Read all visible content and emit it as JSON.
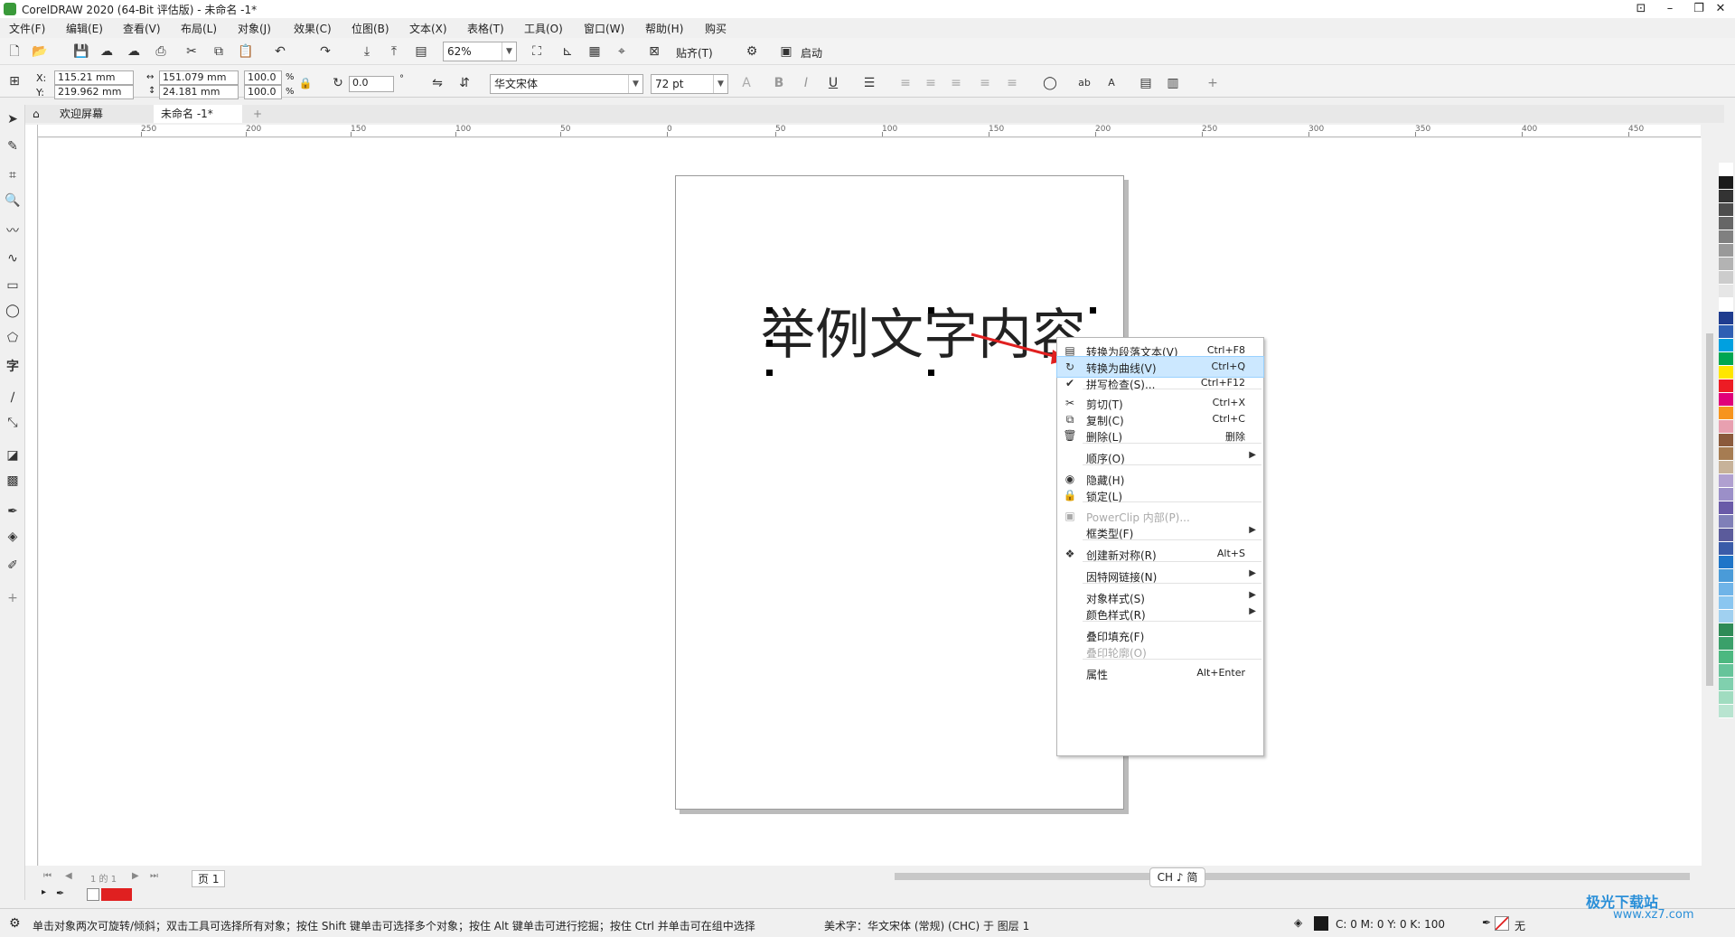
{
  "window": {
    "title": "CorelDRAW 2020 (64-Bit 评估版) - 未命名 -1*"
  },
  "menubar": {
    "items": [
      "文件(F)",
      "编辑(E)",
      "查看(V)",
      "布局(L)",
      "对象(J)",
      "效果(C)",
      "位图(B)",
      "文本(X)",
      "表格(T)",
      "工具(O)",
      "窗口(W)",
      "帮助(H)",
      "购买"
    ]
  },
  "toolbar": {
    "zoom": "62%",
    "snap_label": "贴齐(T)",
    "launch_label": "启动"
  },
  "propbar": {
    "x_label": "X:",
    "y_label": "Y:",
    "x_value": "115.21 mm",
    "y_value": "219.962 mm",
    "w_value": "151.079 mm",
    "h_value": "24.181 mm",
    "scale_w": "100.0",
    "scale_h": "100.0",
    "pct": "%",
    "rotation": "0.0",
    "font_name": "华文宋体",
    "font_size": "72 pt"
  },
  "tabs": {
    "welcome": "欢迎屏幕",
    "document": "未命名 -1*"
  },
  "ruler": {
    "labels": [
      "250",
      "200",
      "150",
      "100",
      "50",
      "0",
      "50",
      "100",
      "150",
      "200",
      "250",
      "300",
      "350",
      "400",
      "450"
    ],
    "unit": "毫米"
  },
  "canvas": {
    "text": "举例文字内容"
  },
  "context_menu": {
    "items": [
      {
        "label": "转换为段落文本(V)",
        "shortcut": "Ctrl+F8",
        "icon": "paragraph-text-icon"
      },
      {
        "label": "转换为曲线(V)",
        "shortcut": "Ctrl+Q",
        "icon": "convert-curves-icon",
        "highlighted": true
      },
      {
        "label": "拼写检查(S)...",
        "shortcut": "Ctrl+F12",
        "icon": "spellcheck-icon"
      },
      {
        "label": "剪切(T)",
        "shortcut": "Ctrl+X",
        "icon": "cut-icon"
      },
      {
        "label": "复制(C)",
        "shortcut": "Ctrl+C",
        "icon": "copy-icon"
      },
      {
        "label": "删除(L)",
        "shortcut": "删除",
        "icon": "trash-icon"
      },
      {
        "label": "顺序(O)",
        "shortcut": "",
        "icon": "",
        "submenu": true
      },
      {
        "label": "隐藏(H)",
        "shortcut": "",
        "icon": "eye-icon"
      },
      {
        "label": "锁定(L)",
        "shortcut": "",
        "icon": "lock-icon"
      },
      {
        "label": "PowerClip 内部(P)...",
        "shortcut": "",
        "icon": "powerclip-icon",
        "disabled": true
      },
      {
        "label": "框类型(F)",
        "shortcut": "",
        "icon": "",
        "submenu": true
      },
      {
        "label": "创建新对称(R)",
        "shortcut": "Alt+S",
        "icon": "symmetry-icon"
      },
      {
        "label": "因特网链接(N)",
        "shortcut": "",
        "icon": "",
        "submenu": true
      },
      {
        "label": "对象样式(S)",
        "shortcut": "",
        "icon": "",
        "submenu": true
      },
      {
        "label": "颜色样式(R)",
        "shortcut": "",
        "icon": "",
        "submenu": true
      },
      {
        "label": "叠印填充(F)",
        "shortcut": "",
        "icon": ""
      },
      {
        "label": "叠印轮廓(O)",
        "shortcut": "",
        "icon": "",
        "disabled": true
      },
      {
        "label": "属性",
        "shortcut": "Alt+Enter",
        "icon": ""
      }
    ]
  },
  "pagenav": {
    "page_of": "1 的 1",
    "page_tab": "页 1"
  },
  "lang_indicator": "CH ♪ 简",
  "statusbar": {
    "hint": "单击对象两次可旋转/倾斜；双击工具可选择所有对象；按住 Shift 键单击可选择多个对象；按住 Alt 键单击可进行挖掘；按住 Ctrl 并单击可在组中选择",
    "info": "美术字：华文宋体 (常规) (CHC) 于 图层 1",
    "cmyk": "C: 0 M: 0 Y: 0 K: 100",
    "outline": "无"
  },
  "watermark": {
    "name": "极光下载站",
    "url": "www.xz7.com"
  },
  "colors": {
    "accent_red": "#e02020",
    "highlight": "#cce8ff",
    "palette": [
      "#ffffff",
      "#1a1a1a",
      "#333333",
      "#4d4d4d",
      "#666666",
      "#808080",
      "#999999",
      "#b3b3b3",
      "#cccccc",
      "#e6e6e6",
      "#ffffff",
      "#1f3c8f",
      "#2f5fb3",
      "#00a0e0",
      "#00a651",
      "#ffe600",
      "#ed1c24",
      "#e0007a",
      "#f7941d",
      "#e8a0b0",
      "#8b5a3c",
      "#a67c52",
      "#c7b299",
      "#b0a0d0",
      "#9b8fc8",
      "#6a5aa8",
      "#7f7fb8",
      "#5b5b9b",
      "#3a5ba8",
      "#1f75c8",
      "#4a9bd8",
      "#6fb4e8",
      "#8ac6f0",
      "#a0d0f0",
      "#2e8b57",
      "#3aa06a",
      "#4cb880",
      "#66c49a",
      "#80d0ae",
      "#a0dcc0",
      "#b8e4d0"
    ]
  }
}
